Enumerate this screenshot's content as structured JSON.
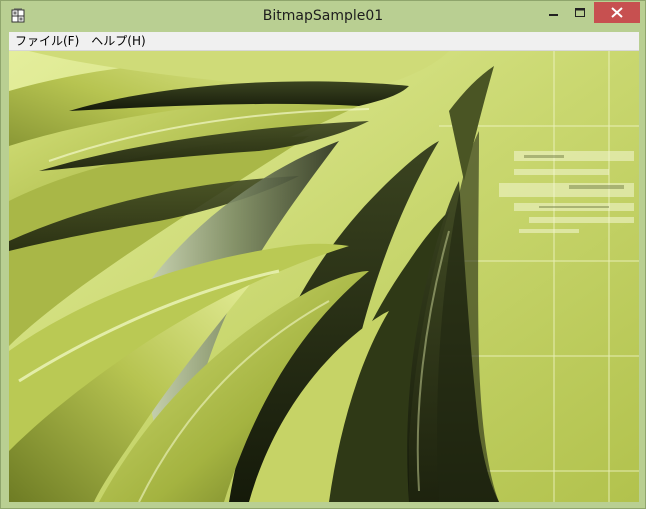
{
  "window": {
    "title": "BitmapSample01"
  },
  "title_icons": {
    "app": "app-icon",
    "minimize": "minimize-icon",
    "maximize": "maximize-icon",
    "close": "close-icon"
  },
  "menu": {
    "items": [
      {
        "label": "ファイル(F)"
      },
      {
        "label": "ヘルプ(H)"
      }
    ]
  },
  "colors": {
    "frame": "#b9cf92",
    "close_button": "#c75050",
    "menubar": "#f0f0f0",
    "image_light": "#d9e58f",
    "image_mid": "#a7b648",
    "image_dark": "#2c3318"
  }
}
